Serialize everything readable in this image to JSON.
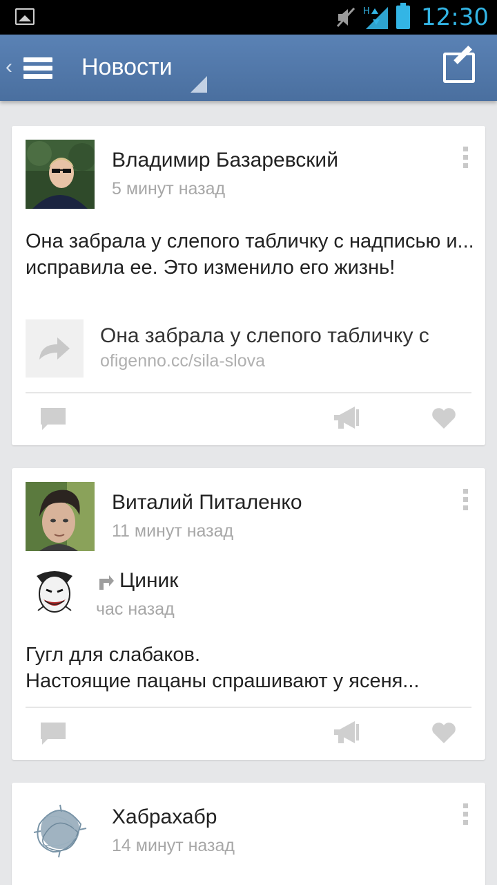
{
  "status_bar": {
    "time": "12:30",
    "network_label": "H"
  },
  "action_bar": {
    "title": "Новости"
  },
  "posts": [
    {
      "author": "Владимир Базаревский",
      "time": "5 минут назад",
      "text": "Она забрала у слепого табличку с надписью и... исправила ее. Это изменило его жизнь!",
      "link": {
        "title": "Она забрала у слепого табличку с",
        "url": "ofigenno.cc/sila-slova"
      }
    },
    {
      "author": "Виталий Питаленко",
      "time": "11 минут назад",
      "repost": {
        "name": "Циник",
        "time": "час назад"
      },
      "text_line1": "Гугл для слабаков.",
      "text_line2": "Настоящие пацаны спрашивают у ясеня..."
    },
    {
      "author": "Хабрахабр",
      "time": "14 минут назад"
    }
  ],
  "icons": {
    "comment": "comment-icon",
    "share": "megaphone-icon",
    "like": "heart-icon",
    "more": "more-vert-icon"
  },
  "colors": {
    "accent": "#33b5e5",
    "actionbar": "#4f76a8",
    "background": "#e6e7e9"
  }
}
